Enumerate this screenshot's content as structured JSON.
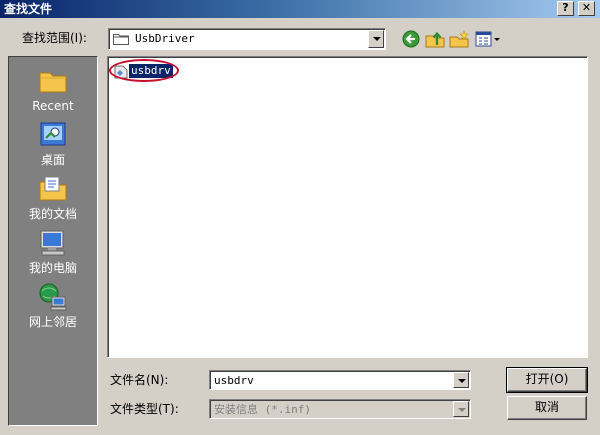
{
  "window": {
    "title": "查找文件"
  },
  "titlebar": {
    "help": "?",
    "close": "✕"
  },
  "lookin": {
    "label": "查找范围(I):",
    "value": "UsbDriver"
  },
  "toolbar": {
    "back_icon": "back-arrow-icon",
    "up_icon": "up-folder-icon",
    "new_folder_icon": "new-folder-icon",
    "view_icon": "view-menu-icon"
  },
  "places": [
    {
      "label": "Recent",
      "icon": "recent-folder-icon"
    },
    {
      "label": "桌面",
      "icon": "desktop-icon"
    },
    {
      "label": "我的文档",
      "icon": "my-documents-icon"
    },
    {
      "label": "我的电脑",
      "icon": "my-computer-icon"
    },
    {
      "label": "网上邻居",
      "icon": "network-icon"
    }
  ],
  "files": [
    {
      "name": "usbdrv",
      "selected": true
    }
  ],
  "filename": {
    "label": "文件名(N):",
    "value": "usbdrv"
  },
  "filetype": {
    "label": "文件类型(T):",
    "value": "安装信息 (*.inf)"
  },
  "buttons": {
    "open": "打开(O)",
    "cancel": "取消"
  },
  "colors": {
    "titlebar": "#0a246a",
    "selection": "#0a246a",
    "annotation": "#c8102e",
    "face": "#d4d0c8"
  }
}
